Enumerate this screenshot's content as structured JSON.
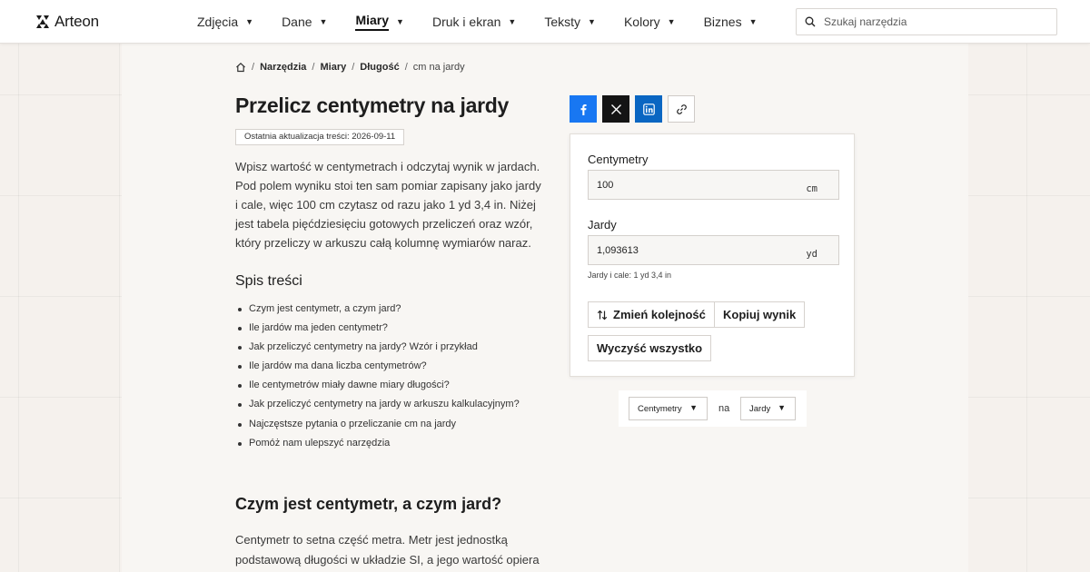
{
  "brand": {
    "name": "Arteon"
  },
  "nav": {
    "items": [
      {
        "label": "Zdjęcia"
      },
      {
        "label": "Dane"
      },
      {
        "label": "Miary"
      },
      {
        "label": "Druk i ekran"
      },
      {
        "label": "Teksty"
      },
      {
        "label": "Kolory"
      },
      {
        "label": "Biznes"
      }
    ],
    "active": "Miary"
  },
  "search": {
    "placeholder": "Szukaj narzędzia"
  },
  "breadcrumb": {
    "items": [
      "Narzędzia",
      "Miary",
      "Długość"
    ],
    "current": "cm na jardy"
  },
  "page": {
    "title": "Przelicz centymetry na jardy",
    "updated": "Ostatnia aktualizacja treści: 2026-09-11",
    "intro": "Wpisz wartość w centymetrach i odczytaj wynik w jardach. Pod polem wyniku stoi ten sam pomiar zapisany jako jardy i cale, więc 100 cm czytasz od razu jako 1 yd 3,4 in. Niżej jest tabela pięćdziesięciu gotowych przeliczeń oraz wzór, który przeliczy w arkuszu całą kolumnę wymiarów naraz."
  },
  "toc": {
    "title": "Spis treści",
    "items": [
      "Czym jest centymetr, a czym jard?",
      "Ile jardów ma jeden centymetr?",
      "Jak przeliczyć centymetry na jardy? Wzór i przykład",
      "Ile jardów ma dana liczba centymetrów?",
      "Ile centymetrów miały dawne miary długości?",
      "Jak przeliczyć centymetry na jardy w arkuszu kalkulacyjnym?",
      "Najczęstsze pytania o przeliczanie cm na jardy",
      "Pomóż nam ulepszyć narzędzia"
    ]
  },
  "section": {
    "title": "Czym jest centymetr, a czym jard?",
    "text": "Centymetr to setna część metra. Metr jest jednostką podstawową długości w układzie SI, a jego wartość opiera"
  },
  "share": {
    "icons": [
      "facebook-icon",
      "x-icon",
      "linkedin-icon",
      "link-icon"
    ],
    "colors": {
      "facebook": "#1877f2",
      "x": "#141414",
      "linkedin": "#0a66c2"
    }
  },
  "converter": {
    "from": {
      "label": "Centymetry",
      "value": "100",
      "unit": "cm"
    },
    "to": {
      "label": "Jardy",
      "value": "1,093613",
      "unit": "yd"
    },
    "hint": "Jardy i cale: 1 yd 3,4 in",
    "buttons": {
      "swap": "Zmień kolejność",
      "copy": "Kopiuj wynik",
      "clear": "Wyczyść wszystko"
    }
  },
  "unit_selector": {
    "from": "Centymetry",
    "connector": "na",
    "to": "Jardy"
  }
}
